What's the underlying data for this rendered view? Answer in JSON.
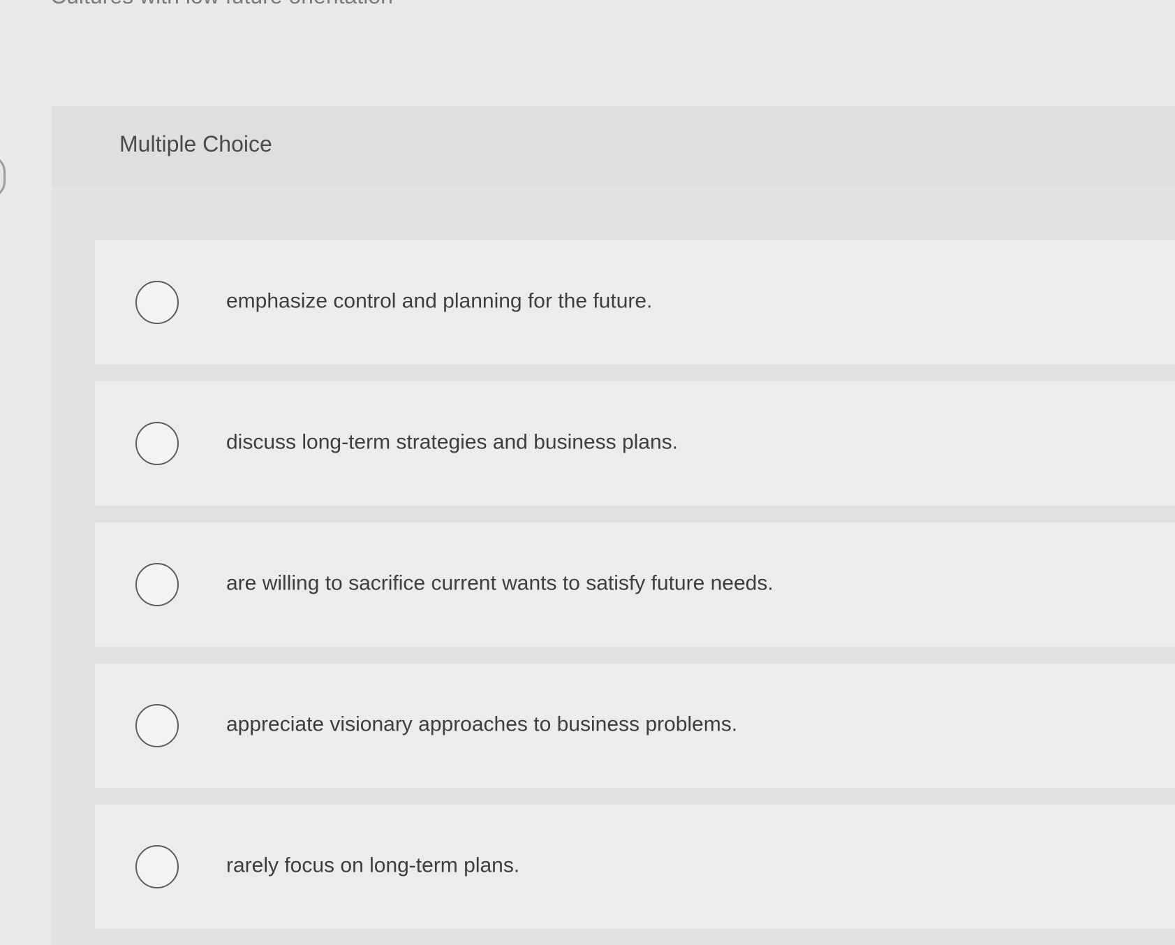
{
  "question": {
    "stem": "Cultures with low future orientation"
  },
  "panel": {
    "title": "Multiple Choice"
  },
  "options": [
    {
      "label": "emphasize control and planning for the future."
    },
    {
      "label": "discuss long-term strategies and business plans."
    },
    {
      "label": "are willing to sacrifice current wants to satisfy future needs."
    },
    {
      "label": "appreciate visionary approaches to business problems."
    },
    {
      "label": "rarely focus on long-term plans."
    }
  ],
  "colors": {
    "background": "#e9eae8",
    "panel": "#e2e3e1",
    "text": "#3d3e40",
    "radio_border": "#5a5c5e"
  }
}
